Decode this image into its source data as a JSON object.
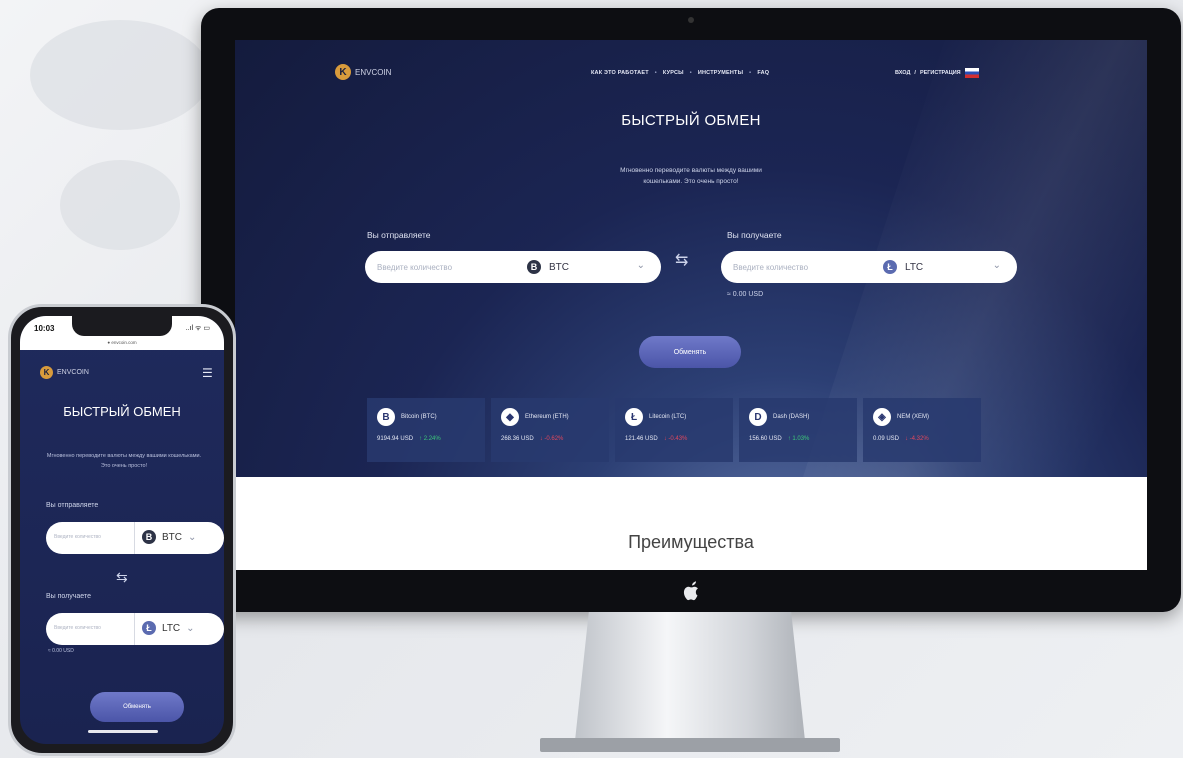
{
  "site": {
    "logo_mark": "K",
    "logo_text": "ENVCOIN",
    "nav": [
      "КАК ЭТО РАБОТАЕТ",
      "КУРСЫ",
      "ИНСТРУМЕНТЫ",
      "FAQ"
    ],
    "nav_sep": "•",
    "auth_login": "ВХОД",
    "auth_sep": "/",
    "auth_register": "РЕГИСТРАЦИЯ"
  },
  "hero": {
    "title": "БЫСТРЫЙ ОБМЕН",
    "subtitle": "Мгновенно переводите валюты между вашими кошельками. Это очень просто!"
  },
  "exchange": {
    "send_label": "Вы отправляете",
    "receive_label": "Вы получаете",
    "amount_placeholder": "Введите количество",
    "send_currency": "BTC",
    "receive_currency": "LTC",
    "approx": "≈ 0.00 USD",
    "button": "Обменять"
  },
  "tickers": [
    {
      "icon": "B",
      "name": "Bitcoin (BTC)",
      "price": "9194.94 USD",
      "change": "↑ 2.24%",
      "dir": "up",
      "color": "#f7931a"
    },
    {
      "icon": "◆",
      "name": "Ethereum (ETH)",
      "price": "268.36 USD",
      "change": "↓ -0.62%",
      "dir": "down",
      "color": "#627eea"
    },
    {
      "icon": "Ł",
      "name": "Litecoin (LTC)",
      "price": "121.46 USD",
      "change": "↓ -0.43%",
      "dir": "down",
      "color": "#345d9d"
    },
    {
      "icon": "D",
      "name": "Dash (DASH)",
      "price": "156.60 USD",
      "change": "↑ 1.03%",
      "dir": "up",
      "color": "#008de4"
    },
    {
      "icon": "◈",
      "name": "NEM (XEM)",
      "price": "0.09 USD",
      "change": "↓ -4.32%",
      "dir": "down",
      "color": "#67b2e8"
    }
  ],
  "advantages": {
    "title": "Преимущества"
  },
  "phone": {
    "time": "10:03",
    "signal": "..ıl ᯤ ▭",
    "url": "● envcoin.com",
    "logo_text": "ENVCOIN",
    "menu_icon": "☰",
    "title": "БЫСТРЫЙ ОБМЕН",
    "subtitle": "Мгновенно переводите валюты между вашими кошельками. Это очень просто!",
    "send_label": "Вы отправляете",
    "receive_label": "Вы получаете",
    "placeholder": "Введите количество",
    "send_currency": "BTC",
    "receive_currency": "LTC",
    "approx": "≈ 0.00 USD",
    "button": "Обменять"
  },
  "colors": {
    "accent": "#5a64b8",
    "screen_bg": "#1b2553",
    "btc": "#f7931a",
    "ltc": "#345d9d"
  }
}
